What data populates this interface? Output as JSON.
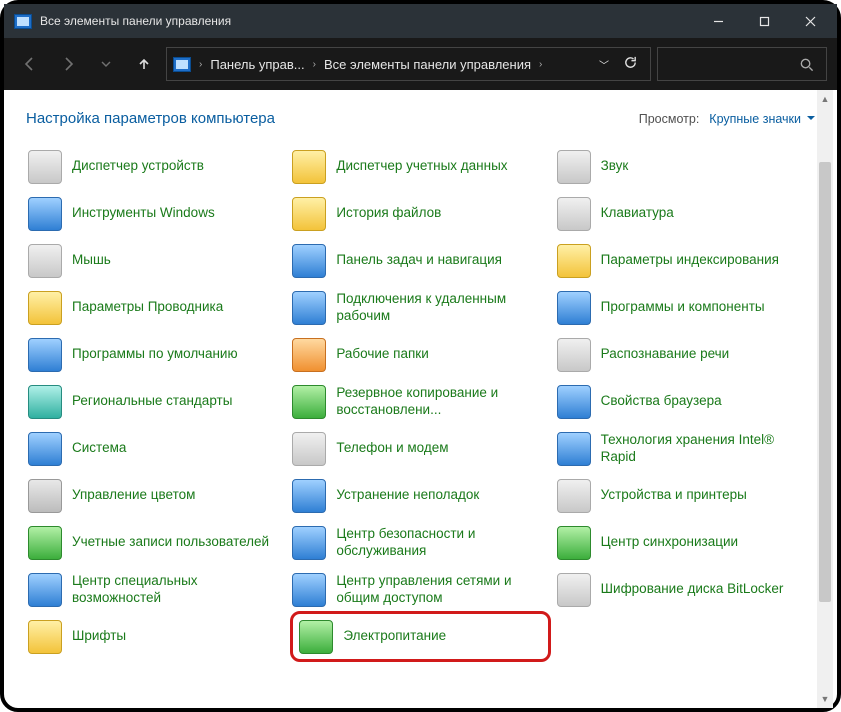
{
  "window": {
    "title": "Все элементы панели управления"
  },
  "breadcrumb": {
    "seg1": "Панель управ...",
    "seg2": "Все элементы панели управления"
  },
  "header": {
    "heading": "Настройка параметров компьютера",
    "view_label": "Просмотр:",
    "view_value": "Крупные значки"
  },
  "items": [
    {
      "label": "Диспетчер устройств",
      "icon": "ic-gray",
      "name": "device-manager"
    },
    {
      "label": "Диспетчер учетных данных",
      "icon": "ic-yellow",
      "name": "credential-manager"
    },
    {
      "label": "Звук",
      "icon": "ic-gray",
      "name": "sound"
    },
    {
      "label": "Инструменты Windows",
      "icon": "ic-blue",
      "name": "windows-tools"
    },
    {
      "label": "История файлов",
      "icon": "ic-yellow",
      "name": "file-history"
    },
    {
      "label": "Клавиатура",
      "icon": "ic-gray",
      "name": "keyboard"
    },
    {
      "label": "Мышь",
      "icon": "ic-gray",
      "name": "mouse"
    },
    {
      "label": "Панель задач и навигация",
      "icon": "ic-blue",
      "name": "taskbar-navigation"
    },
    {
      "label": "Параметры индексирования",
      "icon": "ic-yellow",
      "name": "indexing-options"
    },
    {
      "label": "Параметры Проводника",
      "icon": "ic-yellow",
      "name": "explorer-options"
    },
    {
      "label": "Подключения к удаленным рабочим",
      "icon": "ic-blue",
      "name": "remote-connections"
    },
    {
      "label": "Программы и компоненты",
      "icon": "ic-blue",
      "name": "programs-features"
    },
    {
      "label": "Программы по умолчанию",
      "icon": "ic-blue",
      "name": "default-programs"
    },
    {
      "label": "Рабочие папки",
      "icon": "ic-orange",
      "name": "work-folders"
    },
    {
      "label": "Распознавание речи",
      "icon": "ic-gray",
      "name": "speech-recognition"
    },
    {
      "label": "Региональные стандарты",
      "icon": "ic-teal",
      "name": "region"
    },
    {
      "label": "Резервное копирование и восстановлени...",
      "icon": "ic-green",
      "name": "backup-restore"
    },
    {
      "label": "Свойства браузера",
      "icon": "ic-blue",
      "name": "internet-options"
    },
    {
      "label": "Система",
      "icon": "ic-blue",
      "name": "system"
    },
    {
      "label": "Телефон и модем",
      "icon": "ic-gray",
      "name": "phone-modem"
    },
    {
      "label": "Технология хранения Intel® Rapid",
      "icon": "ic-blue",
      "name": "intel-rapid-storage"
    },
    {
      "label": "Управление цветом",
      "icon": "ic-generic",
      "name": "color-management"
    },
    {
      "label": "Устранение неполадок",
      "icon": "ic-blue",
      "name": "troubleshooting"
    },
    {
      "label": "Устройства и принтеры",
      "icon": "ic-gray",
      "name": "devices-printers"
    },
    {
      "label": "Учетные записи пользователей",
      "icon": "ic-green",
      "name": "user-accounts"
    },
    {
      "label": "Центр безопасности и обслуживания",
      "icon": "ic-blue",
      "name": "security-maintenance"
    },
    {
      "label": "Центр синхронизации",
      "icon": "ic-green",
      "name": "sync-center"
    },
    {
      "label": "Центр специальных возможностей",
      "icon": "ic-blue",
      "name": "ease-of-access"
    },
    {
      "label": "Центр управления сетями и общим доступом",
      "icon": "ic-blue",
      "name": "network-sharing"
    },
    {
      "label": "Шифрование диска BitLocker",
      "icon": "ic-gray",
      "name": "bitlocker"
    },
    {
      "label": "Шрифты",
      "icon": "ic-yellow",
      "name": "fonts"
    },
    {
      "label": "Электропитание",
      "icon": "ic-green",
      "name": "power-options",
      "highlight": true
    }
  ]
}
